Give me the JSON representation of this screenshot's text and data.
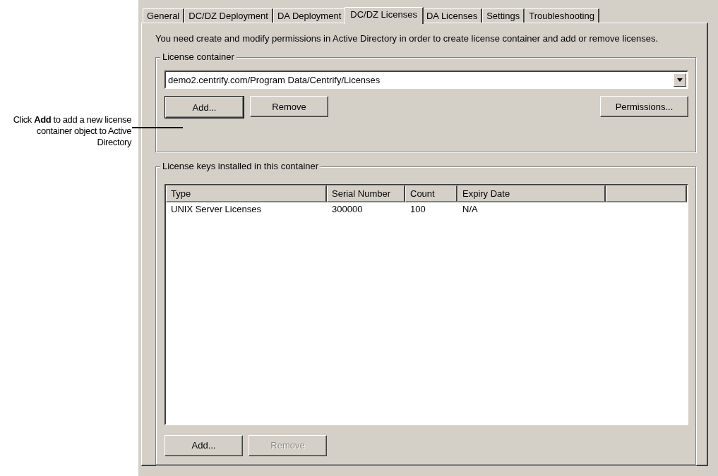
{
  "callout": {
    "text": "Click **Add** to add a new license container object to Active Directory"
  },
  "tabs": [
    {
      "label": "General",
      "selected": false
    },
    {
      "label": "DC/DZ Deployment",
      "selected": false
    },
    {
      "label": "DA Deployment",
      "selected": false
    },
    {
      "label": "DC/DZ Licenses",
      "selected": true
    },
    {
      "label": "DA Licenses",
      "selected": false
    },
    {
      "label": "Settings",
      "selected": false
    },
    {
      "label": "Troubleshooting",
      "selected": false
    }
  ],
  "intro": "You need create and modify permissions in Active Directory in order to create license container and add or remove licenses.",
  "license_container": {
    "title": "License container",
    "value": "demo2.centrify.com/Program Data/Centrify/Licenses",
    "buttons": [
      {
        "label": "Add...",
        "disabled": false,
        "focused": true
      },
      {
        "label": "Remove",
        "disabled": false,
        "focused": false
      }
    ],
    "right_button": {
      "label": "Permissions...",
      "disabled": false
    }
  },
  "license_keys": {
    "title": "License keys installed in this container",
    "columns": [
      "Type",
      "Serial Number",
      "Count",
      "Expiry Date"
    ],
    "rows": [
      [
        "UNIX Server Licenses",
        "300000",
        "100",
        "N/A"
      ]
    ],
    "buttons": [
      {
        "label": "Add...",
        "disabled": false,
        "focused": false
      },
      {
        "label": "Remove",
        "disabled": true,
        "focused": false
      }
    ]
  }
}
